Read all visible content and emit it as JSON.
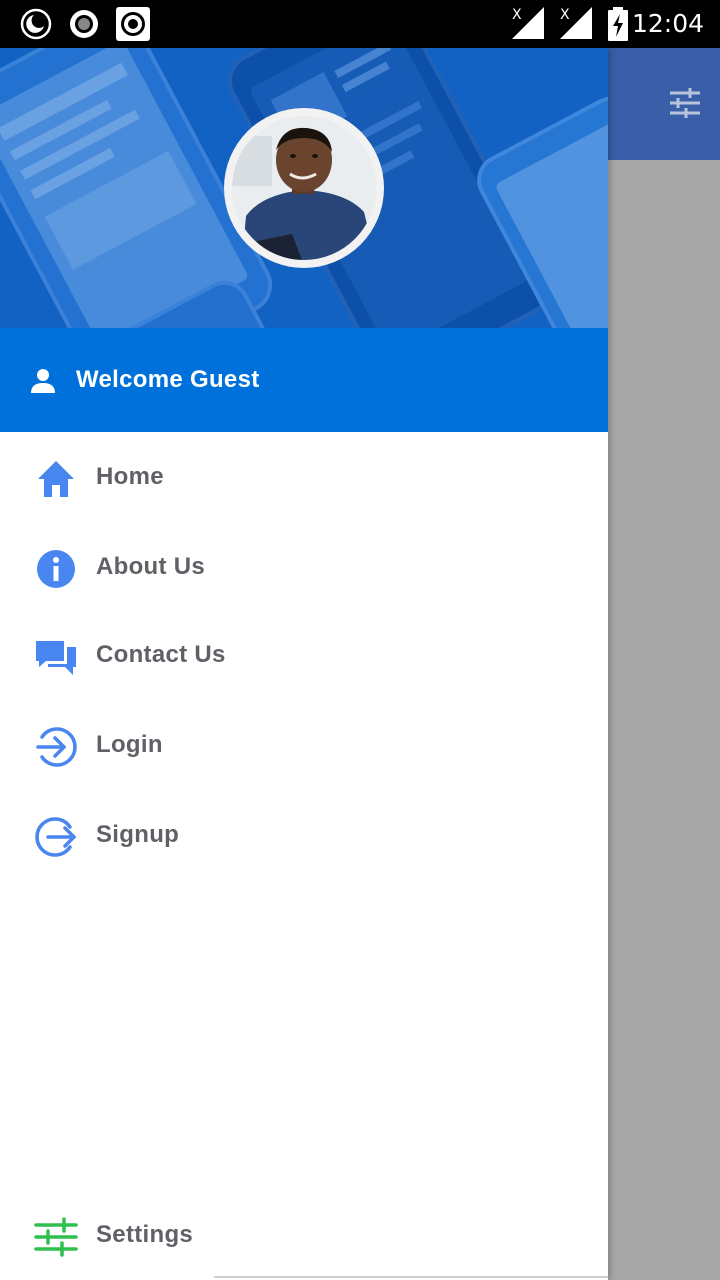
{
  "status_bar": {
    "time": "12:04",
    "icons": [
      "moon-icon",
      "record-icon",
      "target-icon",
      "signal-x-icon",
      "signal-x-icon",
      "battery-charging-icon"
    ]
  },
  "background_app": {
    "header_icon": "tune-icon",
    "header_color": "#3a5fa8"
  },
  "drawer": {
    "header_image": "phone-screens-background",
    "avatar": "user-photo",
    "welcome": {
      "icon": "person-icon",
      "text": "Welcome Guest",
      "bar_color": "#0070db"
    },
    "menu": [
      {
        "label": "Home",
        "icon": "home-icon"
      },
      {
        "label": "About Us",
        "icon": "info-icon"
      },
      {
        "label": "Contact Us",
        "icon": "chat-icon"
      },
      {
        "label": "Login",
        "icon": "login-icon"
      },
      {
        "label": "Signup",
        "icon": "signup-icon"
      }
    ],
    "footer_item": {
      "label": "Settings",
      "icon": "settings-sliders-icon"
    }
  },
  "colors": {
    "icon_blue": "#4a86f0",
    "settings_green": "#2dbf4f",
    "label_gray": "#5f6166"
  }
}
